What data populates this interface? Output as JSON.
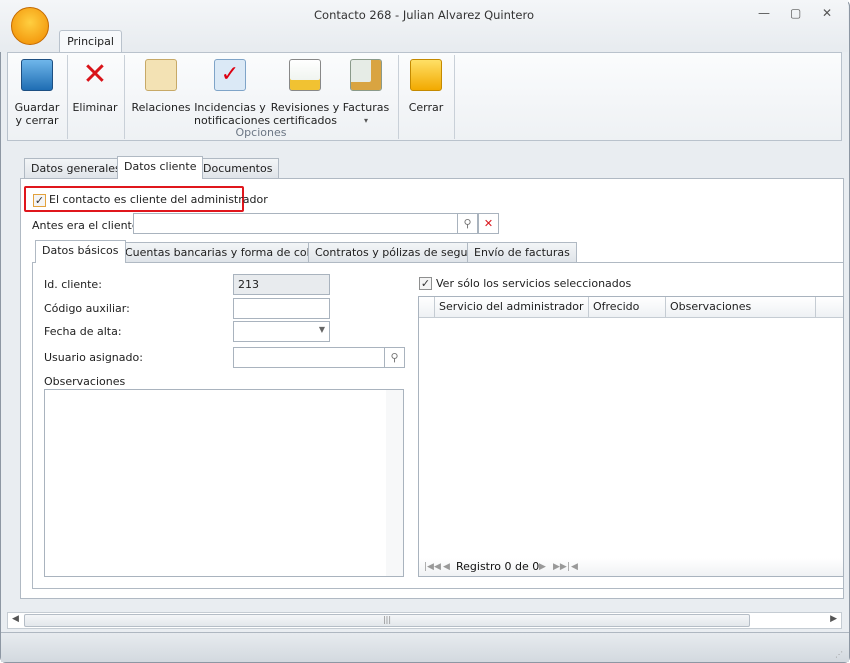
{
  "window": {
    "title": "Contacto 268 - Julian Alvarez Quintero",
    "minimize": "—",
    "maximize": "▢",
    "close": "✕"
  },
  "ribbon": {
    "tab": "Principal",
    "buttons": [
      {
        "label1": "Guardar",
        "label2": "y cerrar",
        "icon": "save-icon"
      },
      {
        "label1": "Eliminar",
        "label2": "",
        "icon": "delete-icon"
      },
      {
        "label1": "Relaciones",
        "label2": "",
        "icon": "relations-icon"
      },
      {
        "label1": "Incidencias y",
        "label2": "notificaciones",
        "icon": "incidents-icon"
      },
      {
        "label1": "Revisiones y",
        "label2": "certificados",
        "icon": "reviews-icon"
      },
      {
        "label1": "Facturas",
        "label2": "▾",
        "icon": "invoices-icon"
      },
      {
        "label1": "Cerrar",
        "label2": "",
        "icon": "close-folder-icon"
      }
    ],
    "group": "Opciones"
  },
  "tabs": [
    "Datos generales",
    "Datos cliente",
    "Documentos"
  ],
  "client": {
    "is_client_label": "El contacto es cliente del administrador",
    "is_client": true,
    "previous_label": "Antes era el cliente:",
    "previous_value": ""
  },
  "subtabs": [
    "Datos básicos",
    "Cuentas bancarias y forma de cobro",
    "Contratos y pólizas de seguro",
    "Envío de facturas"
  ],
  "basic": {
    "id_label": "Id. cliente:",
    "id_value": "213",
    "aux_label": "Código auxiliar:",
    "aux_value": "",
    "date_label": "Fecha de alta:",
    "date_value": "",
    "user_label": "Usuario asignado:",
    "user_value": "",
    "obs_label": "Observaciones"
  },
  "services": {
    "filter_label": "Ver sólo los servicios seleccionados",
    "filter_checked": true,
    "columns": [
      "Servicio del administrador",
      "Ofrecido",
      "Observaciones"
    ],
    "rows": [],
    "navigator": "Registro 0 de 0"
  }
}
